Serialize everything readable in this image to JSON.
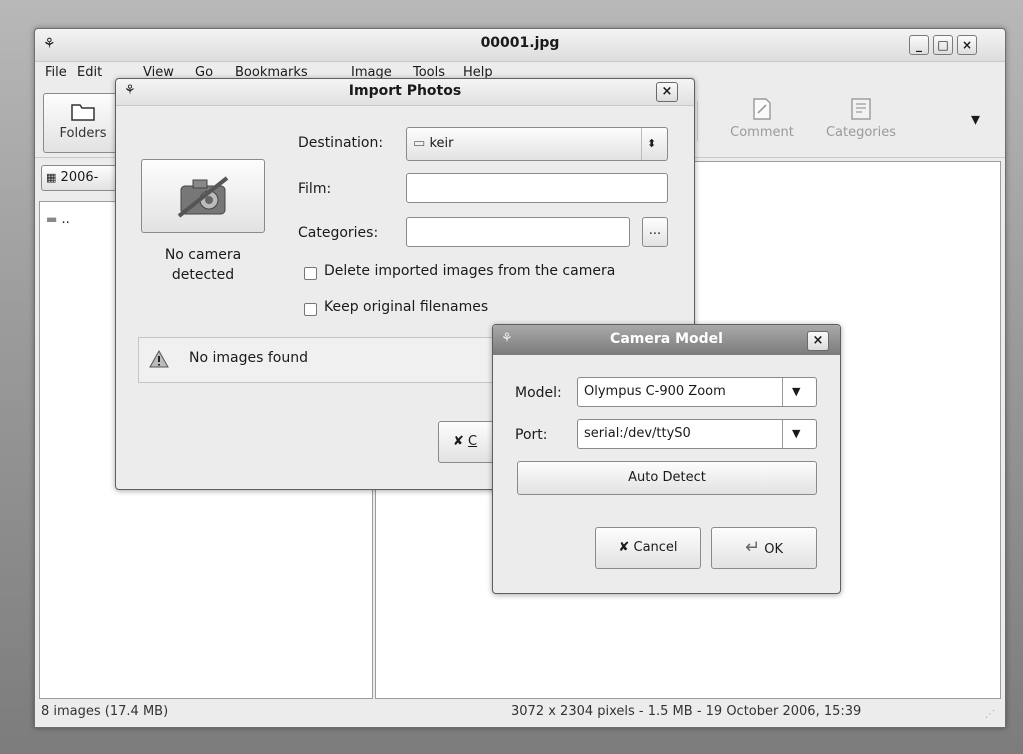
{
  "main_window": {
    "title": "00001.jpg",
    "controls": {
      "minimize": "_",
      "maximize": "□",
      "close": "×"
    },
    "menu": [
      {
        "label": "File"
      },
      {
        "label": "Edit"
      },
      {
        "label": "View"
      },
      {
        "label": "Go"
      },
      {
        "label": "Bookmarks"
      },
      {
        "label": "Image"
      },
      {
        "label": "Tools"
      },
      {
        "label": "Help"
      }
    ],
    "toolbar": {
      "folders_label": "Folders",
      "comment_label": "Comment",
      "categories_label": "Categories",
      "overflow_icon": "▾"
    },
    "location": "2006-",
    "folder_list": [
      ".."
    ],
    "status_left": "8 images (17.4 MB)",
    "status_right": "3072 x 2304 pixels - 1.5 MB - 19 October 2006, 15:39"
  },
  "import_dialog": {
    "title": "Import Photos",
    "close": "×",
    "camera_status": "No camera detected",
    "destination_label": "Destination:",
    "destination_value": "keir",
    "film_label": "Film:",
    "film_value": "",
    "categories_label": "Categories:",
    "categories_value": "",
    "categories_button": "...",
    "delete_checkbox_label": "Delete imported images from the camera",
    "keep_checkbox_label": "Keep original filenames",
    "message": "No images found",
    "cancel_partial": "C"
  },
  "camera_dialog": {
    "title": "Camera Model",
    "close": "×",
    "model_label": "Model:",
    "model_value": "Olympus C-900 Zoom",
    "port_label": "Port:",
    "port_value": "serial:/dev/ttyS0",
    "auto_detect": "Auto Detect",
    "cancel": "Cancel",
    "ok": "OK"
  }
}
